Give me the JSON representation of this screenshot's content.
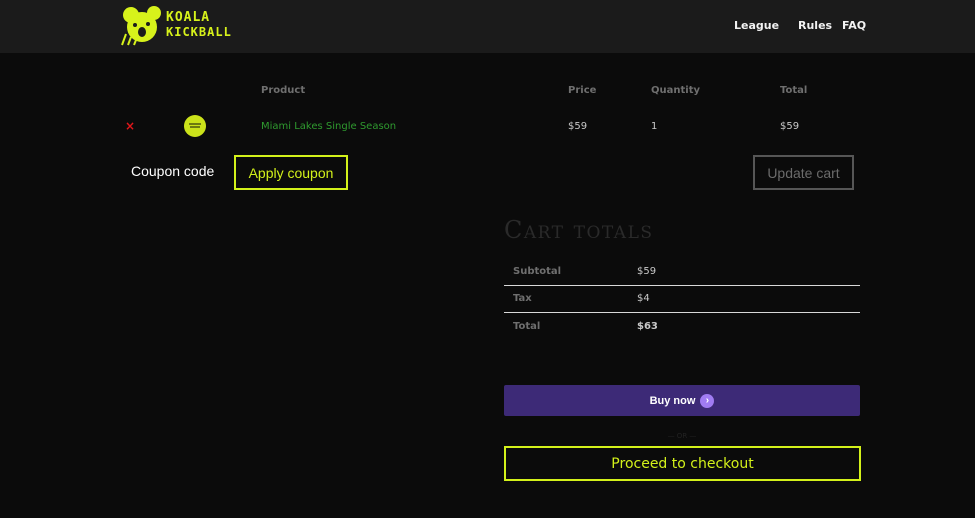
{
  "header": {
    "logo": {
      "line1": "KOALA",
      "line2": "KICKBALL",
      "icon": "koala-icon"
    },
    "nav": [
      {
        "label": "League"
      },
      {
        "label": "Rules"
      },
      {
        "label": "FAQ"
      }
    ]
  },
  "cart": {
    "headers": {
      "product": "Product",
      "price": "Price",
      "quantity": "Quantity",
      "total": "Total"
    },
    "items": [
      {
        "remove_icon": "close-icon",
        "remove_glyph": "×",
        "thumbnail": "koala-kickball-ball",
        "name": "Miami Lakes Single Season",
        "price": "$59",
        "quantity": "1",
        "total": "$59"
      }
    ],
    "coupon": {
      "placeholder": "Coupon code",
      "apply_label": "Apply coupon"
    },
    "update_label": "Update cart"
  },
  "totals": {
    "title": "Cart totals",
    "rows": [
      {
        "label": "Subtotal",
        "value": "$59"
      },
      {
        "label": "Tax",
        "value": "$4"
      },
      {
        "label": "Total",
        "value": "$63"
      }
    ],
    "buy_now_label": "Buy now",
    "buy_arrow": "›",
    "or_text": "— OR —",
    "checkout_label": "Proceed to checkout"
  },
  "colors": {
    "accent": "#d3f11a",
    "background": "#0b0b0b",
    "header": "#1b1b1b",
    "buy_button": "#3d2a77",
    "link_green": "#2f9a2f",
    "remove_red": "#e0161a"
  }
}
